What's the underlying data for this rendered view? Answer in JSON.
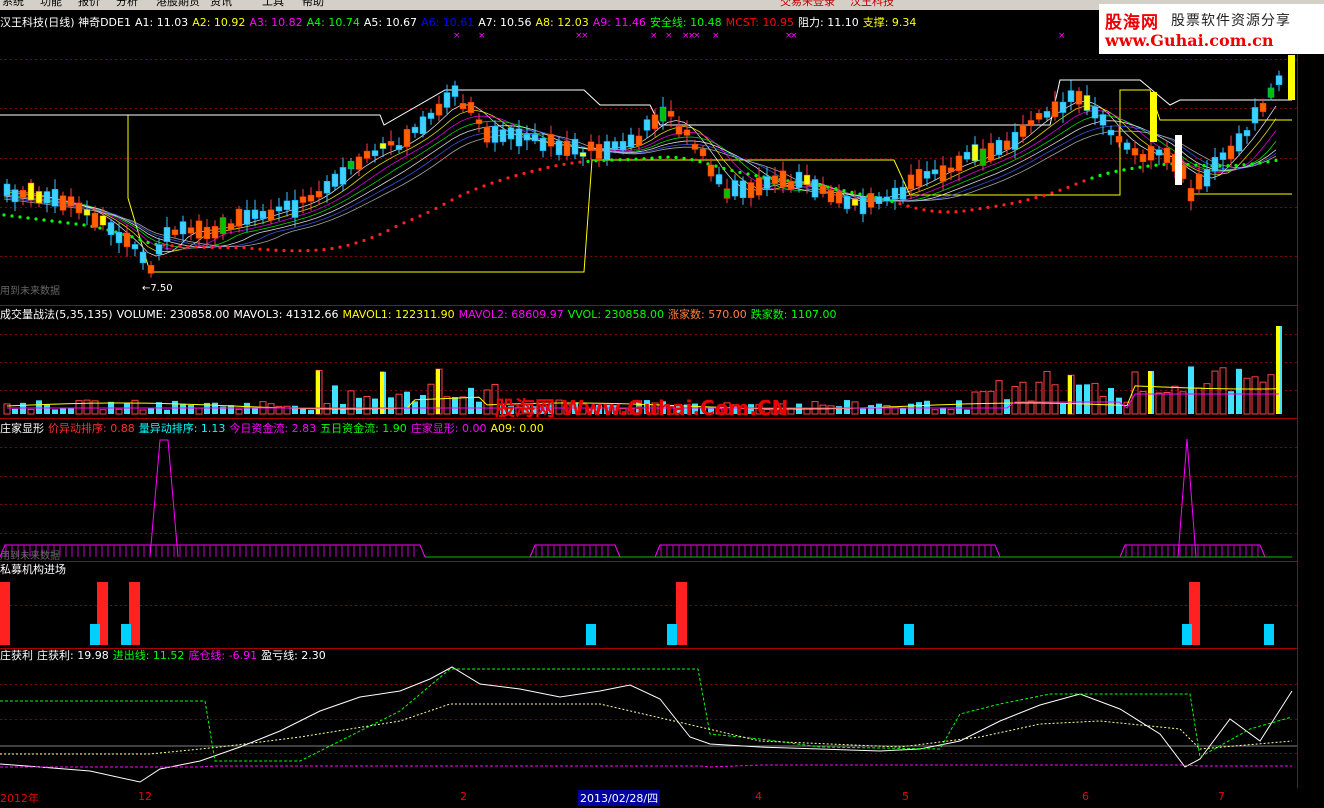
{
  "menu": {
    "items": [
      "系统",
      "功能",
      "报价",
      "分析",
      "港股期货",
      "资讯",
      "工具",
      "帮助"
    ],
    "status": "交易未登录",
    "company": "汉王科技"
  },
  "kline": {
    "title": "汉王科技(日线)",
    "indicator": "神奇DDE1",
    "params": [
      {
        "label": "A1: 11.03",
        "color": "#ffffff"
      },
      {
        "label": "A2: 10.92",
        "color": "#ffff00"
      },
      {
        "label": "A3: 10.82",
        "color": "#ff00ff"
      },
      {
        "label": "A4: 10.74",
        "color": "#00ff00"
      },
      {
        "label": "A5: 10.67",
        "color": "#ffffff"
      },
      {
        "label": "A6: 10.61",
        "color": "#0000ff"
      },
      {
        "label": "A7: 10.56",
        "color": "#ffffff"
      },
      {
        "label": "A8: 12.03",
        "color": "#ffff00"
      },
      {
        "label": "A9: 11.46",
        "color": "#ff00ff"
      },
      {
        "label": "安全线: 10.48",
        "color": "#00ff00"
      },
      {
        "label": "MCST: 10.95",
        "color": "#ff0000"
      },
      {
        "label": "阻力: 11.10",
        "color": "#ffffff"
      },
      {
        "label": "支撑: 9.34",
        "color": "#ffff00"
      }
    ],
    "low_label": "←7.50",
    "future_note": "用到未来数据"
  },
  "volume": {
    "title": "成交量战法(5,35,135)",
    "params": [
      {
        "label": "VOLUME: 230858.00",
        "color": "#ffffff"
      },
      {
        "label": "MAVOL3: 41312.66",
        "color": "#ffffff"
      },
      {
        "label": "MAVOL1: 122311.90",
        "color": "#ffff00"
      },
      {
        "label": "MAVOL2: 68609.97",
        "color": "#ff00ff"
      },
      {
        "label": "VVOL: 230858.00",
        "color": "#00ff00"
      },
      {
        "label": "涨家数: 570.00",
        "color": "#ff8040"
      },
      {
        "label": "跌家数: 1107.00",
        "color": "#00ff00"
      }
    ],
    "watermark": "股海网 Www.Guhai.Com.CN"
  },
  "dealer": {
    "title": "庄家显形",
    "params": [
      {
        "label": "价异动排序: 0.88",
        "color": "#ff3030"
      },
      {
        "label": "量异动排序: 1.13",
        "color": "#00ffff"
      },
      {
        "label": "今日资金流: 2.83",
        "color": "#ff00ff"
      },
      {
        "label": "五日资金流: 1.90",
        "color": "#00ff00"
      },
      {
        "label": "庄家显形: 0.00",
        "color": "#ff00ff"
      },
      {
        "label": "A09: 0.00",
        "color": "#ffff00"
      }
    ],
    "future_note": "用到未来数据"
  },
  "fund": {
    "title": "私募机构进场"
  },
  "profit": {
    "title": "庄获利",
    "params": [
      {
        "label": "庄获利: 19.98",
        "color": "#ffffff"
      },
      {
        "label": "进出线: 11.52",
        "color": "#00ff00"
      },
      {
        "label": "底仓线: -6.91",
        "color": "#ff00ff"
      },
      {
        "label": "盈亏线: 2.30",
        "color": "#ffffff"
      }
    ]
  },
  "xaxis": {
    "labels": [
      "2012年",
      "12",
      "2",
      "2013/02/28/四",
      "4",
      "5",
      "6",
      "7"
    ]
  },
  "logo": {
    "name": "股海网",
    "slogan": "股票软件资源分享",
    "url": "www.Guhai.com.cn"
  }
}
